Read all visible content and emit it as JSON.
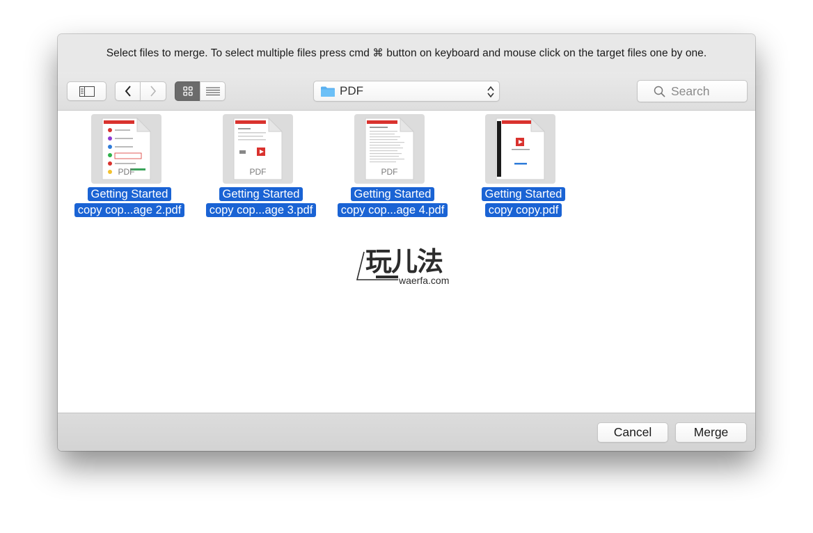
{
  "dialog": {
    "message": "Select files to merge. To select multiple files press cmd ⌘ button on keyboard and mouse click on the target files one by one."
  },
  "toolbar": {
    "sidebar_icon": "sidebar-toggle-icon",
    "back_icon": "chevron-left-icon",
    "forward_icon": "chevron-right-icon",
    "view_icon_mode_icon": "grid-icon",
    "view_list_mode_icon": "list-icon",
    "location": "PDF",
    "location_icon": "folder-icon",
    "search_placeholder": "Search",
    "search_icon": "magnifier-icon"
  },
  "files": [
    {
      "name_line1": "Getting Started",
      "name_line2": "copy cop...age 2.pdf",
      "thumb_label": "PDF",
      "selected": true
    },
    {
      "name_line1": "Getting Started",
      "name_line2": "copy cop...age 3.pdf",
      "thumb_label": "PDF",
      "selected": true
    },
    {
      "name_line1": "Getting Started",
      "name_line2": "copy cop...age 4.pdf",
      "thumb_label": "PDF",
      "selected": true
    },
    {
      "name_line1": "Getting Started",
      "name_line2": "copy copy.pdf",
      "thumb_label": "",
      "selected": true
    }
  ],
  "watermark": {
    "title": "玩儿法",
    "subtitle": "waerfa.com"
  },
  "buttons": {
    "cancel": "Cancel",
    "merge": "Merge"
  },
  "colors": {
    "selection": "#1a63d4",
    "folder": "#5ab0f0",
    "pdf_red": "#d9322e"
  }
}
